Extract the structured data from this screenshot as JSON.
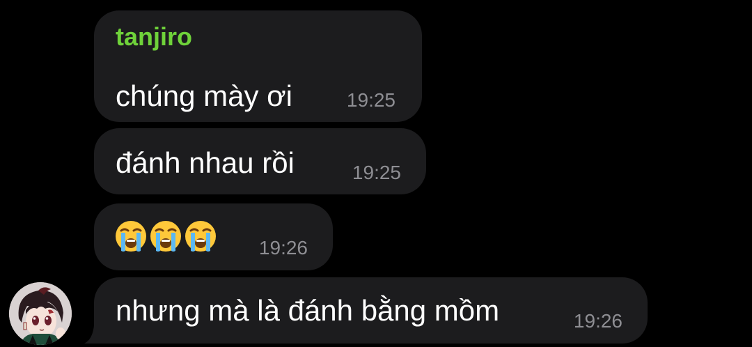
{
  "colors": {
    "background": "#000000",
    "bubble": "#1c1c1e",
    "sender_name": "#6fd23a",
    "timestamp": "#8e8e93",
    "text": "#ffffff"
  },
  "conversation": {
    "sender": "tanjiro",
    "avatar_icon": "tanjiro-avatar-icon",
    "messages": [
      {
        "text": "chúng mày ơi",
        "time": "19:25"
      },
      {
        "text": "đánh nhau rồi",
        "time": "19:25"
      },
      {
        "text": "",
        "emoji": [
          "loudly-crying-face-icon",
          "loudly-crying-face-icon",
          "loudly-crying-face-icon"
        ],
        "time": "19:26"
      },
      {
        "text": "nhưng mà là đánh bằng mồm",
        "time": "19:26"
      }
    ]
  }
}
